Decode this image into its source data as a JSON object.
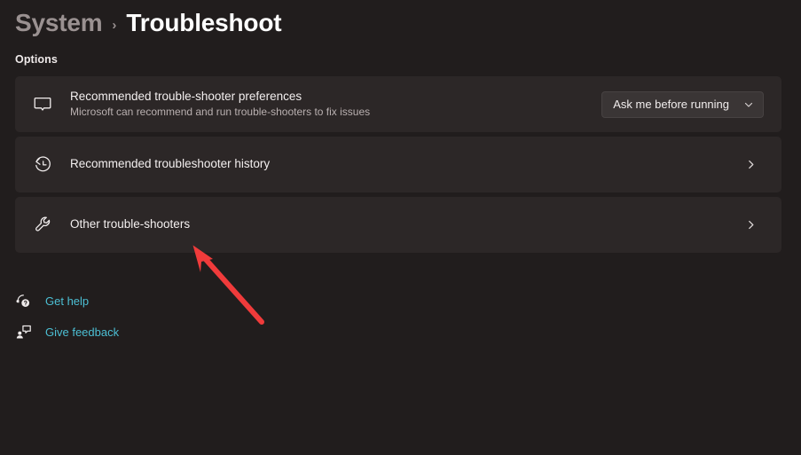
{
  "header": {
    "parent": "System",
    "separator": "›",
    "current": "Troubleshoot"
  },
  "section": {
    "label": "Options"
  },
  "cards": [
    {
      "icon": "speech-bubble-icon",
      "title": "Recommended trouble-shooter preferences",
      "subtitle": "Microsoft can recommend and run trouble-shooters to fix issues",
      "control": "dropdown",
      "dropdown_value": "Ask me before running"
    },
    {
      "icon": "history-clock-icon",
      "title": "Recommended troubleshooter history",
      "subtitle": "",
      "control": "chevron",
      "dropdown_value": ""
    },
    {
      "icon": "wrench-icon",
      "title": "Other trouble-shooters",
      "subtitle": "",
      "control": "chevron",
      "dropdown_value": ""
    }
  ],
  "links": [
    {
      "icon": "help-headset-icon",
      "label": "Get help"
    },
    {
      "icon": "feedback-person-icon",
      "label": "Give feedback"
    }
  ],
  "annotation": {
    "type": "arrow",
    "color": "#f03b3b"
  },
  "colors": {
    "page_background": "#211d1d",
    "card_background": "#2c2727",
    "accent_link": "#4cbfd4",
    "annotation_red": "#f03b3b",
    "title_text": "#ffffff",
    "muted_text": "#b9b0b0"
  }
}
